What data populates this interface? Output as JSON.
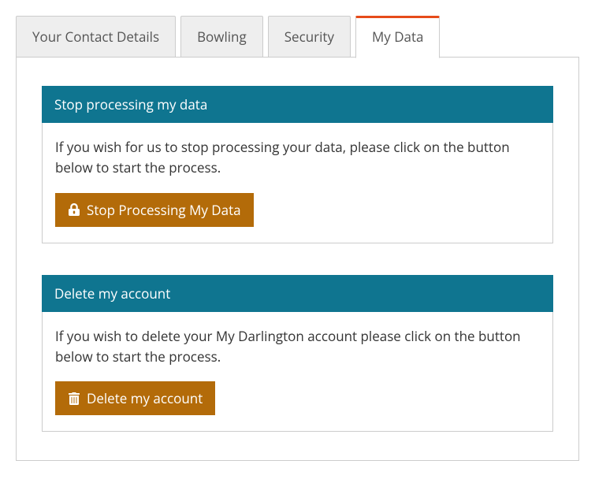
{
  "tabs": [
    {
      "label": "Your Contact Details",
      "active": false
    },
    {
      "label": "Bowling",
      "active": false
    },
    {
      "label": "Security",
      "active": false
    },
    {
      "label": "My Data",
      "active": true
    }
  ],
  "panels": {
    "stop_processing": {
      "header": "Stop processing my data",
      "body": "If you wish for us to stop processing your data, please click on the button below to start the process.",
      "button_label": "Stop Processing My Data"
    },
    "delete_account": {
      "header": "Delete my account",
      "body": "If you wish to delete your My Darlington account please click on the button below to start the process.",
      "button_label": "Delete my account"
    }
  }
}
